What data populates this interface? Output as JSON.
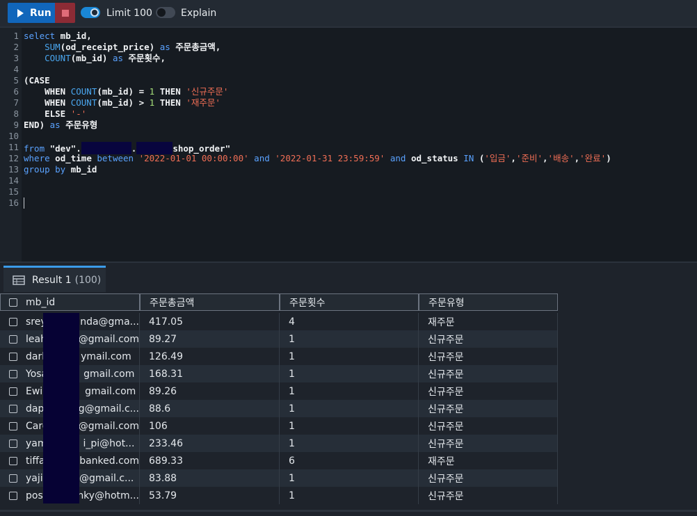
{
  "toolbar": {
    "run_label": "Run",
    "limit_label": "Limit 100",
    "limit_on": true,
    "explain_label": "Explain",
    "explain_on": false
  },
  "editor": {
    "line_numbers": [
      "1",
      "2",
      "3",
      "4",
      "5",
      "6",
      "7",
      "8",
      "9",
      "10",
      "11",
      "12",
      "13",
      "14",
      "15",
      "16"
    ],
    "lines": {
      "l1a": "select",
      "l1b": " mb_id,",
      "l2a": "    SUM",
      "l2b": "(od_receipt_price) ",
      "l2c": "as",
      "l2d": " 주문총금액,",
      "l3a": "    COUNT",
      "l3b": "(mb_id) ",
      "l3c": "as",
      "l3d": " 주문횟수,",
      "l5a": "(CASE",
      "l6a": "    WHEN ",
      "l6b": "COUNT",
      "l6c": "(mb_id) = ",
      "l6d": "1",
      "l6e": " THEN ",
      "l6f": "'신규주문'",
      "l7a": "    WHEN ",
      "l7b": "COUNT",
      "l7c": "(mb_id) > ",
      "l7d": "1",
      "l7e": " THEN ",
      "l7f": "'재주문'",
      "l8a": "    ELSE ",
      "l8b": "'-'",
      "l9a": "END) ",
      "l9b": "as",
      "l9c": " 주문유형",
      "l11a": "from",
      "l11b": " \"dev\".",
      "l11c": ".",
      "l11d": "shop_order\"",
      "l12a": "where",
      "l12b": " od_time ",
      "l12c": "between",
      "l12d": " ",
      "l12e": "'2022-01-01 00:00:00'",
      "l12f": " ",
      "l12g": "and",
      "l12h": " ",
      "l12i": "'2022-01-31 23:59:59'",
      "l12j": " ",
      "l12k": "and",
      "l12l": " od_status ",
      "l12m": "IN",
      "l12n": " (",
      "l12o": "'입금'",
      "l12p": ",",
      "l12q": "'준비'",
      "l12r": ",",
      "l12s": "'배송'",
      "l12t": ",",
      "l12u": "'완료'",
      "l12v": ")",
      "l13a": "group by",
      "l13b": " mb_id"
    }
  },
  "results": {
    "tab_label": "Result 1",
    "tab_count": "(100)",
    "columns": [
      "mb_id",
      "주문총금액",
      "주문횟수",
      "주문유형"
    ],
    "rows": [
      [
        "srey",
        "nda@gma...",
        "417.05",
        "4",
        "재주문"
      ],
      [
        "leah",
        "@gmail.com",
        "89.27",
        "1",
        "신규주문"
      ],
      [
        "darl",
        "ymail.com",
        "126.49",
        "1",
        "신규주문"
      ],
      [
        "Yosa",
        "gmail.com",
        "168.31",
        "1",
        "신규주문"
      ],
      [
        "Ewin",
        "gmail.com",
        "89.26",
        "1",
        "신규주문"
      ],
      [
        "dap",
        "g@gmail.c...",
        "88.6",
        "1",
        "신규주문"
      ],
      [
        "Caro",
        "@gmail.com",
        "106",
        "1",
        "신규주문"
      ],
      [
        "yam",
        "i_pi@hot...",
        "233.46",
        "1",
        "신규주문"
      ],
      [
        "tiffa",
        "banked.com",
        "689.33",
        "6",
        "재주문"
      ],
      [
        "yaji",
        "@gmail.c...",
        "83.88",
        "1",
        "신규주문"
      ],
      [
        "posi",
        "nky@hotm...",
        "53.79",
        "1",
        "신규주문"
      ]
    ]
  }
}
